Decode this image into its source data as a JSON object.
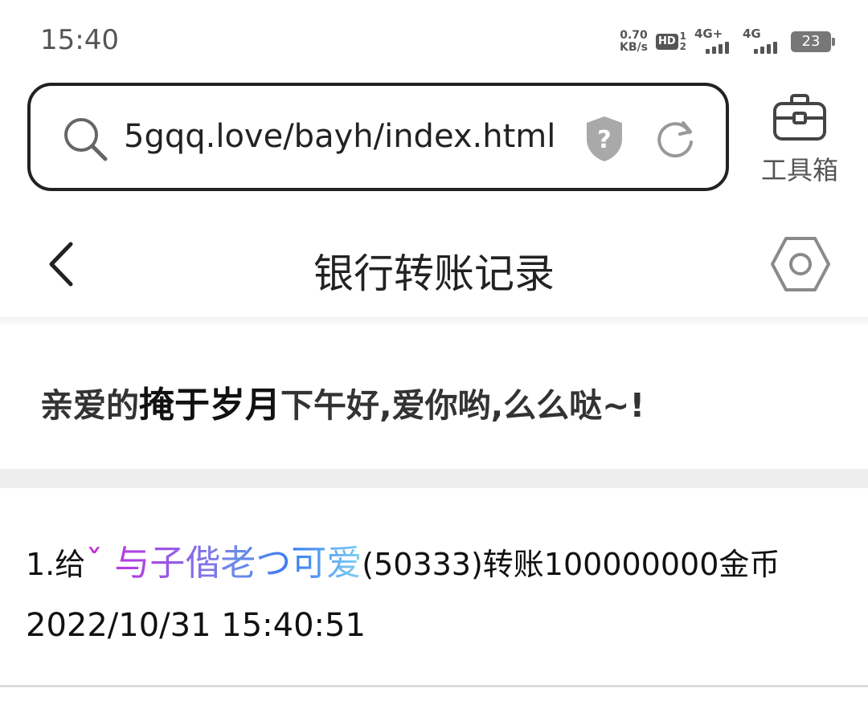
{
  "status_bar": {
    "time": "15:40",
    "net_speed_value": "0.70",
    "net_speed_unit": "KB/s",
    "hd_label": "HD",
    "hd_sim1": "1",
    "hd_sim2": "2",
    "network1": "4G+",
    "network2": "4G",
    "battery": "23"
  },
  "browser": {
    "url": "5gqq.love/bayh/index.html",
    "toolbox_label": "工具箱",
    "icons": [
      "search-icon",
      "shield-question-icon",
      "refresh-icon",
      "toolbox-icon"
    ]
  },
  "header": {
    "title": "银行转账记录",
    "icons": [
      "back-arrow-icon",
      "settings-hex-icon"
    ]
  },
  "greeting": {
    "prefix": "亲爱的",
    "name": "掩于岁月",
    "suffix": "下午好,爱你哟,么么哒~!"
  },
  "records": [
    {
      "index_prefix": "1.给",
      "recipient": "ˇ 与子偕老つ可爱",
      "details": "(50333)转账100000000金币",
      "timestamp": "2022/10/31 15:40:51"
    }
  ]
}
